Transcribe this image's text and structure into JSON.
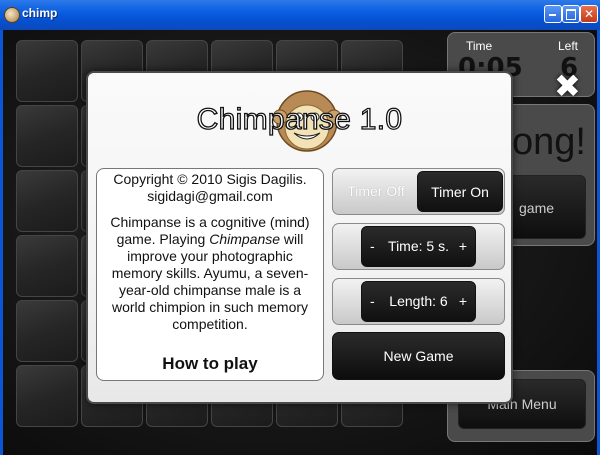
{
  "window": {
    "title": "chimp"
  },
  "background": {
    "time_label": "Time",
    "time_value": "0:05",
    "left_label": "Left",
    "left_value": "6",
    "status_fragment": "ong!",
    "game_fragment": "game",
    "main_menu": "Main Menu"
  },
  "dialog": {
    "title": "Chimpanse 1.0",
    "logo_icon": "chimp-face-icon",
    "copyright": "Copyright © 2010 Sigis Dagilis.",
    "email": "sigidagi@gmail.com",
    "description_1": "Chimpanse is a cognitive (mind) game. Playing ",
    "description_em": "Chimpanse",
    "description_2": " will improve your photographic memory skills. Ayumu, a seven-year-old chimpanse male is a world chimpion in such memory competition.",
    "how_to_play": "How to play",
    "timer_off": "Timer Off",
    "timer_on": "Timer On",
    "time_stepper": {
      "minus": "-",
      "label": "Time: 5 s.",
      "plus": "+"
    },
    "length_stepper": {
      "minus": "-",
      "label": "Length: 6",
      "plus": "+"
    },
    "new_game": "New Game"
  },
  "colors": {
    "titlebar": "#0a5ee1",
    "accent_dark": "#101010"
  }
}
